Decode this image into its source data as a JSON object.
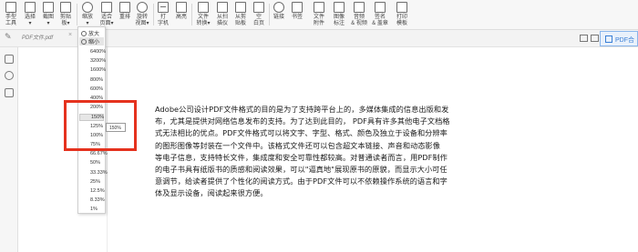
{
  "toolbar": {
    "tools": [
      {
        "name": "hand-tool",
        "icon": "hand-icon",
        "label": "手型\n工具"
      },
      {
        "name": "select-tool",
        "icon": "cursor-icon",
        "label": "选择\n▾"
      },
      {
        "name": "screenshot-tool",
        "icon": "screenshot-icon",
        "label": "截图\n▾"
      },
      {
        "name": "clipboard-tool",
        "icon": "clipboard-icon",
        "label": "剪贴\n板▾"
      },
      {
        "name": "zoom-tool",
        "icon": "zoom-icon",
        "label": "缩放\n▾"
      },
      {
        "name": "fit-page-tool",
        "icon": "fit-page-icon",
        "label": "适合\n页面▾"
      },
      {
        "name": "reflow-tool",
        "icon": "reflow-icon",
        "label": "重排"
      },
      {
        "name": "rotate-view-tool",
        "icon": "rotate-icon",
        "label": "旋转\n视图▾"
      },
      {
        "name": "typewriter-tool",
        "icon": "typewriter-icon",
        "label": "打\n字机"
      },
      {
        "name": "highlight-tool",
        "icon": "highlight-icon",
        "label": "高亮"
      },
      {
        "name": "file-convert-tool",
        "icon": "file-convert-icon",
        "label": "文件\n转换▾"
      },
      {
        "name": "from-scanner-tool",
        "icon": "scanner-icon",
        "label": "从扫\n描仪"
      },
      {
        "name": "from-clipboard-tool",
        "icon": "paste-icon",
        "label": "从剪\n贴板"
      },
      {
        "name": "blank-page-tool",
        "icon": "blank-page-icon",
        "label": "空\n白页"
      },
      {
        "name": "link-tool",
        "icon": "link-icon",
        "label": "链接"
      },
      {
        "name": "bookmark-tool",
        "icon": "bookmark-icon",
        "label": "书签"
      },
      {
        "name": "file-attachment-tool",
        "icon": "attachment-icon",
        "label": "文件\n附件"
      },
      {
        "name": "image-annotation-tool",
        "icon": "image-icon",
        "label": "图像\n标注"
      },
      {
        "name": "audio-video-tool",
        "icon": "media-icon",
        "label": "音频\n& 视频"
      },
      {
        "name": "sign-stamp-tool",
        "icon": "stamp-icon",
        "label": "签名\n& 盖章"
      },
      {
        "name": "print-tool",
        "icon": "print-icon",
        "label": "打印\n模板"
      }
    ]
  },
  "tab": {
    "file_name": "PDF文件.pdf",
    "close": "×"
  },
  "badge": {
    "label": "PDF合"
  },
  "zoom_menu": {
    "zoom_in": "放大",
    "zoom_out": "缩小",
    "levels": [
      "6400%",
      "3200%",
      "1600%",
      "800%",
      "600%",
      "400%",
      "200%",
      "150%",
      "125%",
      "100%",
      "75%",
      "66.67%",
      "50%",
      "33.33%",
      "25%",
      "12.5%",
      "8.33%",
      "1%"
    ],
    "selected": "150%",
    "tooltip": "150%"
  },
  "document": {
    "paragraph": "Adobe公司设计PDF文件格式的目的是为了支持跨平台上的，多媒体集成的信息出版和发\n布，尤其是提供对网络信息发布的支持。为了达到此目的， PDF具有许多其他电子文档格\n式无法相比的优点。PDF文件格式可以将文字、字型、格式、颜色及独立于设备和分辨率\n的图形图像等封装在一个文件中。该格式文件还可以包含超文本链接、声音和动态影像\n等电子信息，支持特长文件，集成度和安全可靠性都较高。对普通读者而言，用PDF制作\n的电子书具有纸版书的质感和阅读效果，可以\"逼真地\"展现原书的原貌，而显示大小可任\n意调节，给读者提供了个性化的阅读方式。由于PDF文件可以不依赖操作系统的语言和字\n体及显示设备，阅读起来很方便。"
  },
  "highlight_color": "#e5321e"
}
